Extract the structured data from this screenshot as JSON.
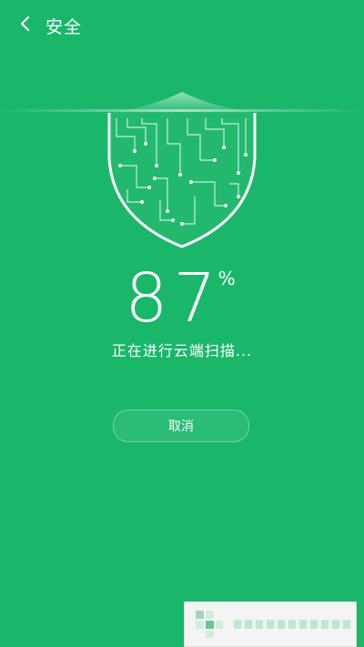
{
  "header": {
    "title": "安全",
    "back_icon": "chevron-left-icon"
  },
  "scan": {
    "percent": "87",
    "percent_sign": "%",
    "status": "正在进行云端扫描..."
  },
  "actions": {
    "cancel_label": "取消"
  },
  "colors": {
    "background": "#1ab76a",
    "text": "#ffffff"
  }
}
